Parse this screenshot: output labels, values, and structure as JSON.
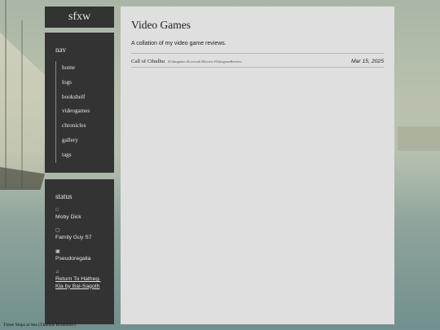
{
  "site": {
    "title": "sfxw"
  },
  "nav": {
    "heading": "nav",
    "items": [
      {
        "label": "home"
      },
      {
        "label": "logs"
      },
      {
        "label": "bookshelf"
      },
      {
        "label": "videogames"
      },
      {
        "label": "chronicles"
      },
      {
        "label": "gallery"
      },
      {
        "label": "tags"
      }
    ]
  },
  "status": {
    "heading": "status",
    "items": [
      {
        "icon": "book-icon",
        "text": "Moby Dick"
      },
      {
        "icon": "tv-icon",
        "text": "Family Guy S7"
      },
      {
        "icon": "gamepad-icon",
        "text": "Pseudoregalia"
      },
      {
        "icon": "music-note-icon",
        "text": "Return To Hatheg-Kla by Bal-Sagoth",
        "link": true
      }
    ]
  },
  "main": {
    "title": "Video Games",
    "description": "A collation of my video game reviews.",
    "posts": [
      {
        "title": "Call of Cthulhu",
        "tags": "#Videogames #Lovecraft #Review #VideogameReviews",
        "date": "Mar 15, 2025"
      }
    ]
  },
  "caption": "Three Ships at Sea (Thomas Bradshaw)"
}
